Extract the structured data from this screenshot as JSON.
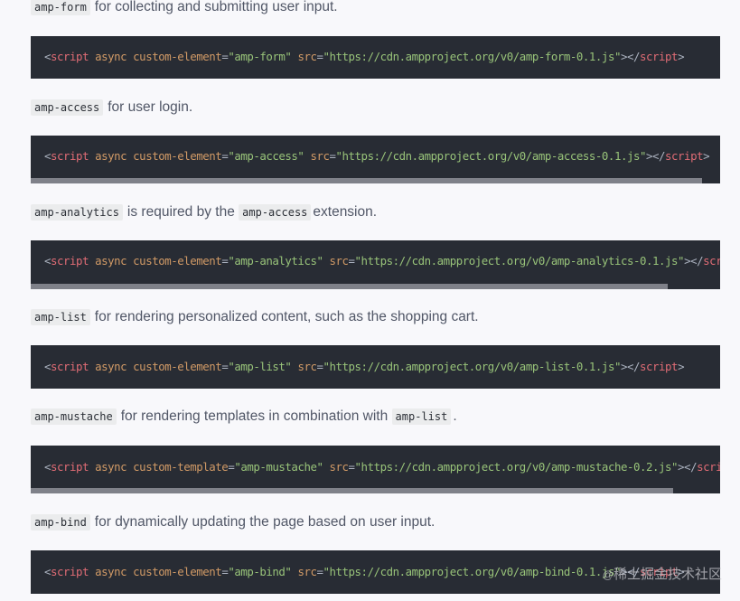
{
  "sections": [
    {
      "para": {
        "pre": "amp-form",
        "text": "for collecting and submitting user input.",
        "mid": "",
        "text2": ""
      },
      "code": {
        "tag": "script",
        "attr1": "async",
        "attr2": "custom-element",
        "val2": "\"amp-form\"",
        "attr3": "src",
        "val3": "\"https://cdn.ampproject.org/v0/amp-form-0.1.js\""
      }
    },
    {
      "para": {
        "pre": "amp-access",
        "text": "for user login.",
        "mid": "",
        "text2": ""
      },
      "code": {
        "tag": "script",
        "attr1": "async",
        "attr2": "custom-element",
        "val2": "\"amp-access\"",
        "attr3": "src",
        "val3": "\"https://cdn.ampproject.org/v0/amp-access-0.1.js\""
      }
    },
    {
      "para": {
        "pre": "amp-analytics",
        "text": "is required by the",
        "mid": "amp-access",
        "text2": "extension."
      },
      "code": {
        "tag": "script",
        "attr1": "async",
        "attr2": "custom-element",
        "val2": "\"amp-analytics\"",
        "attr3": "src",
        "val3": "\"https://cdn.ampproject.org/v0/amp-analytics-0.1.js\""
      }
    },
    {
      "para": {
        "pre": "amp-list",
        "text": "for rendering personalized content, such as the shopping cart.",
        "mid": "",
        "text2": ""
      },
      "code": {
        "tag": "script",
        "attr1": "async",
        "attr2": "custom-element",
        "val2": "\"amp-list\"",
        "attr3": "src",
        "val3": "\"https://cdn.ampproject.org/v0/amp-list-0.1.js\""
      }
    },
    {
      "para": {
        "pre": "amp-mustache",
        "text": "for rendering templates in combination with",
        "mid": "amp-list",
        "text2": "."
      },
      "code": {
        "tag": "script",
        "attr1": "async",
        "attr2": "custom-template",
        "val2": "\"amp-mustache\"",
        "attr3": "src",
        "val3": "\"https://cdn.ampproject.org/v0/amp-mustache-0.2.js\""
      }
    },
    {
      "para": {
        "pre": "amp-bind",
        "text": "for dynamically updating the page based on user input.",
        "mid": "",
        "text2": ""
      },
      "code": {
        "tag": "script",
        "attr1": "async",
        "attr2": "custom-element",
        "val2": "\"amp-bind\"",
        "attr3": "src",
        "val3": "\"https://cdn.ampproject.org/v0/amp-bind-0.1.js\""
      }
    }
  ],
  "punct": {
    "lt": "<",
    "gt": ">",
    "close_open": "></",
    "eq": "="
  },
  "watermark": {
    "at": "@",
    "text": "稀土掘金技术社区"
  }
}
